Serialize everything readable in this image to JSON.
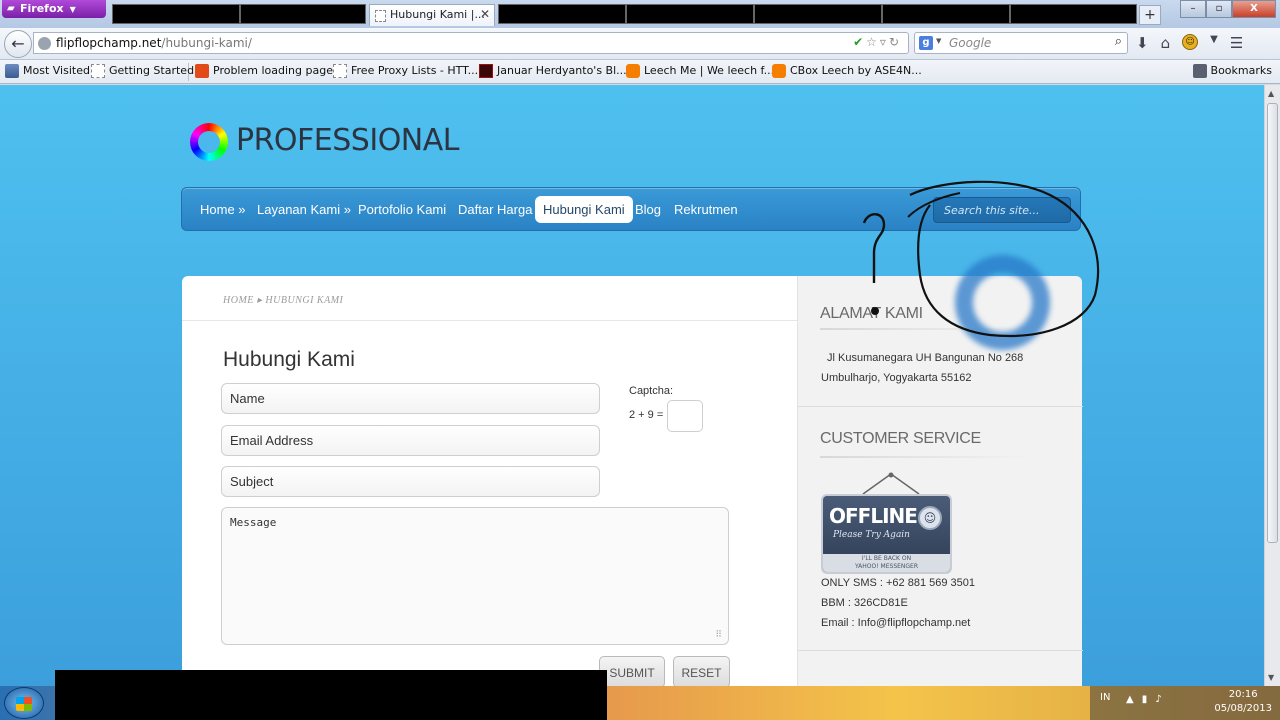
{
  "browser": {
    "menu_label": "Firefox",
    "active_tab_title": "Hubungi Kami |...",
    "new_tab_label": "+",
    "url_domain": "flipflopchamp.net",
    "url_path": "/hubungi-kami/",
    "search_engine": "Google",
    "search_placeholder": "Google",
    "window_buttons": [
      "–",
      "▫",
      "X"
    ]
  },
  "bookmarks": [
    {
      "label": "Most Visited",
      "icon": "most-visited-icon"
    },
    {
      "label": "Getting Started",
      "icon": "page-icon"
    },
    {
      "label": "Problem loading page",
      "icon": "ct-icon"
    },
    {
      "label": "Free Proxy Lists - HTT...",
      "icon": "page-icon"
    },
    {
      "label": "Januar Herdyanto's Bl...",
      "icon": "site-icon"
    },
    {
      "label": "Leech Me | We leech f...",
      "icon": "blogger-icon"
    },
    {
      "label": "CBox Leech by ASE4N...",
      "icon": "blogger-icon"
    }
  ],
  "bookmarks_menu": "Bookmarks",
  "site": {
    "logo_text": "PROFESSIONAL",
    "nav": [
      "Home »",
      "Layanan Kami »",
      "Portofolio Kami",
      "Daftar Harga",
      "Hubungi Kami",
      "Blog",
      "Rekrutmen"
    ],
    "search_placeholder": "Search this site..."
  },
  "content": {
    "breadcrumb_home": "HOME",
    "breadcrumb_sep": "▸",
    "breadcrumb_current": "HUBUNGI KAMI",
    "title": "Hubungi Kami",
    "form": {
      "name_placeholder": "Name",
      "email_placeholder": "Email Address",
      "subject_placeholder": "Subject",
      "message_placeholder": "Message",
      "captcha_label": "Captcha:",
      "captcha_question": "2 + 9 =",
      "submit_label": "SUBMIT",
      "reset_label": "RESET"
    }
  },
  "sidebar": {
    "address_heading": "ALAMAT KAMI",
    "address_line1": "Jl Kusumanegara UH Bangunan No 268",
    "address_line2": "Umbulharjo, Yogyakarta 55162",
    "cs_heading": "CUSTOMER SERVICE",
    "offline_badge": {
      "title": "OFFLINE",
      "subtitle": "Please Try Again",
      "footer_line1": "I'LL BE BACK ON",
      "footer_line2": "YAHOO! MESSENGER",
      "icon": "yahoo-messenger-icon"
    },
    "sms": "ONLY SMS : +62 881 569 3501",
    "bbm": "BBM : 326CD81E",
    "email": "Email : Info@flipflopchamp.net"
  },
  "taskbar": {
    "language": "IN",
    "time": "20:16",
    "date": "05/08/2013"
  }
}
